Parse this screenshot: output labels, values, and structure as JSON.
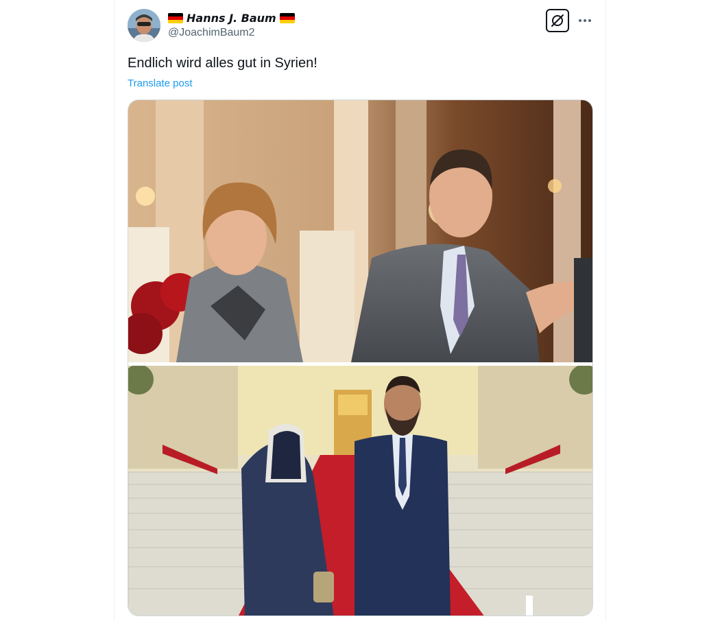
{
  "author": {
    "name": "Hanns J. Baum",
    "handle": "@JoachimBaum2",
    "flag_icon": "german-flag-icon",
    "flag_colors": [
      "#000000",
      "#dd0000",
      "#ffce00"
    ]
  },
  "header_actions": {
    "grok_icon": "grok-icon",
    "more_icon": "more-horizontal-icon"
  },
  "post": {
    "text": "Endlich wird alles gut in Syrien!",
    "translate_label": "Translate post"
  },
  "media": {
    "images": [
      {
        "name": "photo-couple-formal-room"
      },
      {
        "name": "photo-couple-red-carpet-stairs"
      }
    ]
  },
  "colors": {
    "text_primary": "#0f1419",
    "text_secondary": "#536471",
    "link": "#1d9bf0",
    "border": "#cfd9de"
  }
}
